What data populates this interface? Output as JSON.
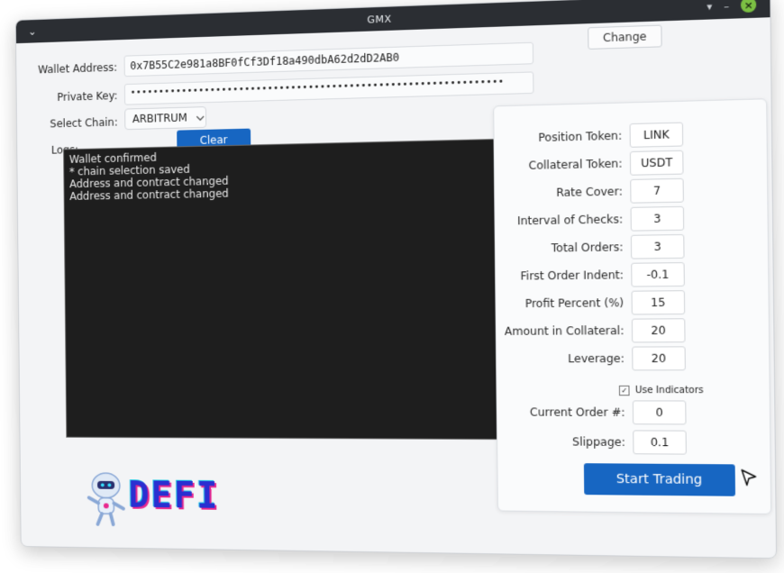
{
  "window": {
    "title": "GMX",
    "menu_glyph": "⌄",
    "controls": {
      "pin": "▾",
      "minimize": "–",
      "close": "×"
    }
  },
  "wallet": {
    "label": "Wallet Address:",
    "value": "0x7B55C2e981a8BF0fCf3Df18a490dbA62d2dD2AB0",
    "change_label": "Change"
  },
  "private_key": {
    "label": "Private Key:",
    "value": "••••••••••••••••••••••••••••••••••••••••••••••••••••••••••••••••"
  },
  "chain": {
    "label": "Select Chain:",
    "value": "ARBITRUM"
  },
  "logs": {
    "label": "Logs:",
    "clear_label": "Clear",
    "lines": [
      "Wallet confirmed",
      "* chain selection saved",
      "Address and contract changed",
      "Address and contract changed"
    ]
  },
  "settings": {
    "position_token": {
      "label": "Position Token:",
      "value": "LINK"
    },
    "collateral_token": {
      "label": "Collateral Token:",
      "value": "USDT"
    },
    "rate_cover": {
      "label": "Rate Cover:",
      "value": "7"
    },
    "interval": {
      "label": "Interval of Checks:",
      "value": "3"
    },
    "total_orders": {
      "label": "Total Orders:",
      "value": "3"
    },
    "first_indent": {
      "label": "First Order Indent:",
      "value": "-0.1"
    },
    "profit_percent": {
      "label": "Profit Percent (%)",
      "value": "15"
    },
    "amount_collateral": {
      "label": "Amount in Collateral:",
      "value": "20"
    },
    "leverage": {
      "label": "Leverage:",
      "value": "20"
    },
    "use_indicators": {
      "label": "Use Indicators",
      "checked": true
    },
    "current_order": {
      "label": "Current Order #:",
      "value": "0"
    },
    "slippage": {
      "label": "Slippage:",
      "value": "0.1"
    },
    "start_label": "Start Trading"
  },
  "logo": {
    "text": "DEFI"
  },
  "colors": {
    "accent": "#1766c2",
    "titlebar": "#2b2e33",
    "log_bg": "#1e1e1e",
    "close_button": "#7bc043"
  }
}
